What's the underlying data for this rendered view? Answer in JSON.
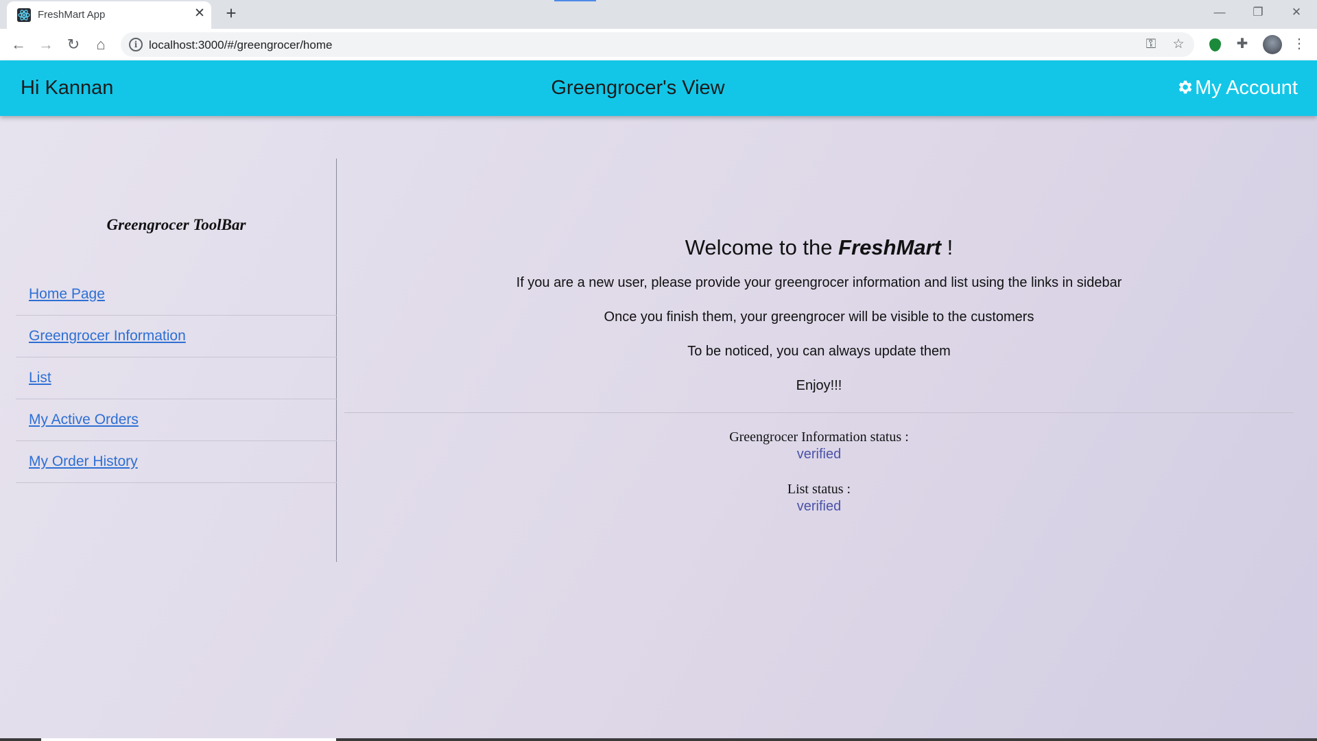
{
  "browser": {
    "tab_title": "FreshMart App",
    "url": "localhost:3000/#/greengrocer/home"
  },
  "header": {
    "greeting": "Hi Kannan",
    "title": "Greengrocer's View",
    "account_label": "My Account",
    "background_color": "#13c6e8"
  },
  "sidebar": {
    "title": "Greengrocer ToolBar",
    "items": [
      {
        "label": "Home Page"
      },
      {
        "label": "Greengrocer Information"
      },
      {
        "label": "List"
      },
      {
        "label": "My Active Orders"
      },
      {
        "label": "My Order History"
      }
    ]
  },
  "main": {
    "welcome_prefix": "Welcome to the",
    "brand": "FreshMart",
    "welcome_suffix": "!",
    "messages": [
      "If you are a new user, please provide your greengrocer information and list using the links in sidebar",
      "Once you finish them, your greengrocer will be visible to the customers",
      "To be noticed, you can always update them",
      "Enjoy!!!"
    ],
    "statuses": [
      {
        "label": "Greengrocer Information status :",
        "value": "verified"
      },
      {
        "label": "List status :",
        "value": "verified"
      }
    ]
  }
}
